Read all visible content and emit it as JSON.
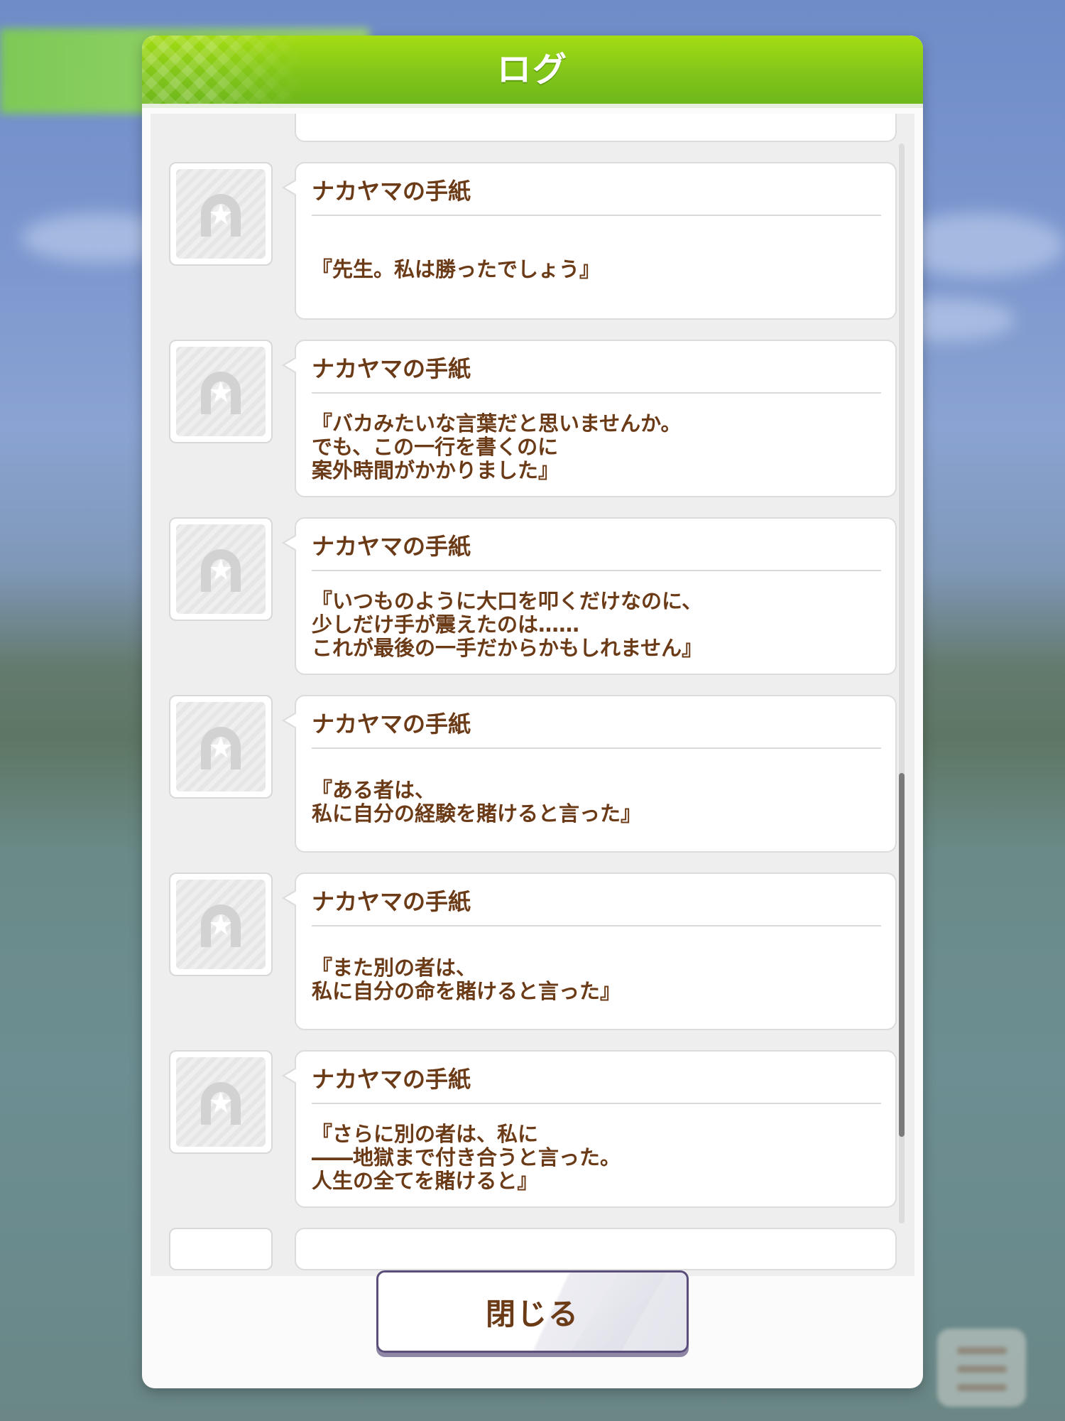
{
  "dialog": {
    "title": "ログ",
    "close_label": "閉じる"
  },
  "entries": [
    {
      "speaker": "ナカヤマの手紙",
      "message": "『先生。私は勝ったでしょう』"
    },
    {
      "speaker": "ナカヤマの手紙",
      "message": "『バカみたいな言葉だと思いませんか。\nでも、この一行を書くのに\n案外時間がかかりました』"
    },
    {
      "speaker": "ナカヤマの手紙",
      "message": "『いつものように大口を叩くだけなのに、\n少しだけ手が震えたのは……\nこれが最後の一手だからかもしれません』"
    },
    {
      "speaker": "ナカヤマの手紙",
      "message": "『ある者は、\n私に自分の経験を賭けると言った』"
    },
    {
      "speaker": "ナカヤマの手紙",
      "message": "『また別の者は、\n私に自分の命を賭けると言った』"
    },
    {
      "speaker": "ナカヤマの手紙",
      "message": "『さらに別の者は、私に\n――地獄まで付き合うと言った。\n人生の全てを賭けると』"
    }
  ],
  "icons": {
    "avatar": "horseshoe-star-icon"
  }
}
